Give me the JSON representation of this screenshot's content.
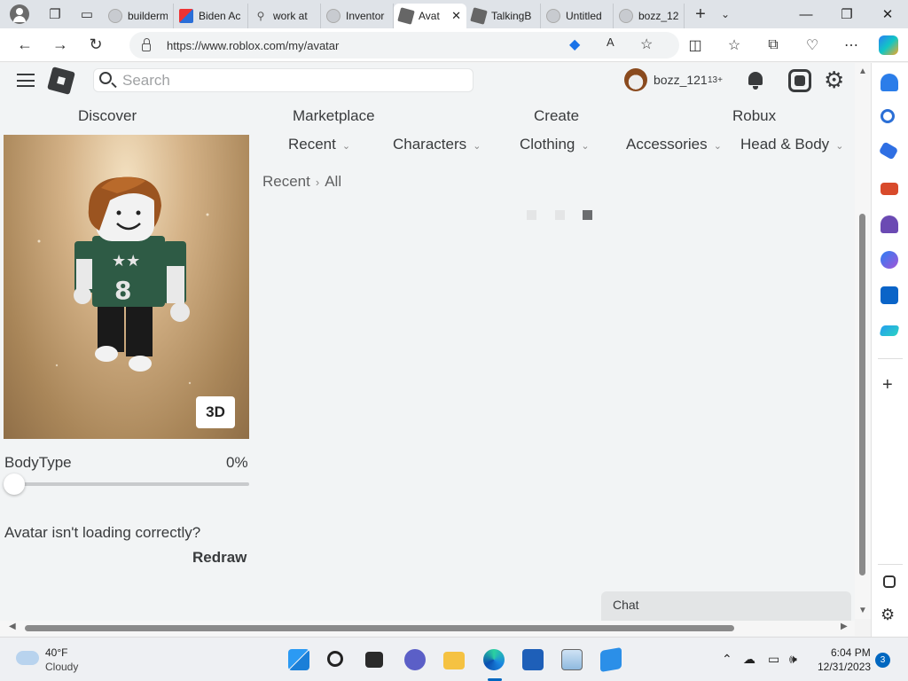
{
  "browser": {
    "tabs": [
      {
        "label": "builderm",
        "icon": "page-icon"
      },
      {
        "label": "Biden Ac",
        "icon": "biden-favicon"
      },
      {
        "label": "work at",
        "icon": "search-icon"
      },
      {
        "label": "Inventor",
        "icon": "page-icon"
      },
      {
        "label": "Avat",
        "icon": "roblox-icon",
        "active": true
      },
      {
        "label": "TalkingB",
        "icon": "roblox-icon"
      },
      {
        "label": "Untitled",
        "icon": "page-icon"
      },
      {
        "label": "bozz_12",
        "icon": "page-icon"
      }
    ],
    "url": "https://www.roblox.com/my/avatar"
  },
  "roblox": {
    "search_placeholder": "Search",
    "username": "bozz_121",
    "age_badge": "13+",
    "nav": [
      "Discover",
      "Marketplace",
      "Create",
      "Robux"
    ],
    "categories": [
      "Recent",
      "Characters",
      "Clothing",
      "Accessories",
      "Head & Body"
    ],
    "breadcrumb": {
      "parent": "Recent",
      "separator": "›",
      "current": "All"
    },
    "btn_3d": "3D",
    "bodytype_label": "BodyType",
    "bodytype_value": "0%",
    "bodytype_fraction": 0,
    "avatar_help": "Avatar isn't loading correctly?",
    "redraw": "Redraw",
    "chat": "Chat"
  },
  "taskbar": {
    "temp": "40°F",
    "condition": "Cloudy",
    "time": "6:04 PM",
    "date": "12/31/2023",
    "notifications": "3"
  },
  "colors": {
    "roblox_text": "#393b3d",
    "page_bg": "#f2f4f5",
    "accent_blue": "#0067c0"
  }
}
